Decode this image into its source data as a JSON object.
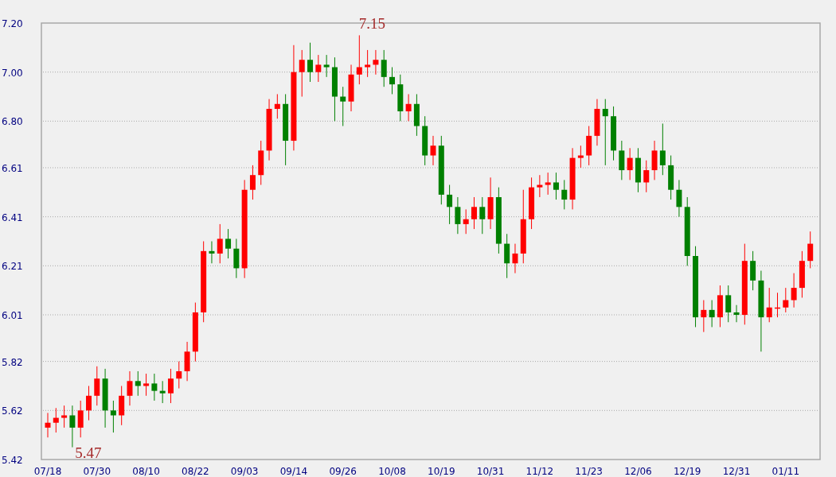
{
  "chart_data": {
    "type": "candlestick",
    "grid": true,
    "ylim": [
      5.42,
      7.2
    ],
    "yticks": [
      5.42,
      5.62,
      5.82,
      6.01,
      6.21,
      6.41,
      6.61,
      {
        "value": 6.8,
        "label": "6.80"
      },
      {
        "value": 7.0,
        "label": "7.00"
      },
      {
        "value": 7.2,
        "label": "7.20"
      }
    ],
    "categories": [
      "07/18",
      null,
      null,
      null,
      null,
      null,
      "07/30",
      null,
      null,
      null,
      null,
      null,
      "08/10",
      null,
      null,
      null,
      null,
      null,
      "08/22",
      null,
      null,
      null,
      null,
      null,
      "09/03",
      null,
      null,
      null,
      null,
      null,
      "09/14",
      null,
      null,
      null,
      null,
      null,
      "09/26",
      null,
      null,
      null,
      null,
      null,
      "10/08",
      null,
      null,
      null,
      null,
      null,
      "10/19",
      null,
      null,
      null,
      null,
      null,
      "10/31",
      null,
      null,
      null,
      null,
      null,
      "11/12",
      null,
      null,
      null,
      null,
      null,
      "11/23",
      null,
      null,
      null,
      null,
      null,
      "12/06",
      null,
      null,
      null,
      null,
      null,
      "12/19",
      null,
      null,
      null,
      null,
      null,
      "12/31",
      null,
      null,
      null,
      null,
      null,
      "01/11",
      null,
      null,
      null
    ],
    "ohlc": [
      [
        5.55,
        5.61,
        5.51,
        5.57
      ],
      [
        5.57,
        5.63,
        5.53,
        5.59
      ],
      [
        5.59,
        5.64,
        5.55,
        5.6
      ],
      [
        5.6,
        5.64,
        5.47,
        5.55
      ],
      [
        5.55,
        5.66,
        5.51,
        5.62
      ],
      [
        5.62,
        5.72,
        5.58,
        5.68
      ],
      [
        5.68,
        5.8,
        5.64,
        5.75
      ],
      [
        5.75,
        5.79,
        5.55,
        5.62
      ],
      [
        5.62,
        5.66,
        5.53,
        5.6
      ],
      [
        5.6,
        5.72,
        5.56,
        5.68
      ],
      [
        5.68,
        5.78,
        5.64,
        5.74
      ],
      [
        5.74,
        5.78,
        5.68,
        5.72
      ],
      [
        5.72,
        5.77,
        5.68,
        5.73
      ],
      [
        5.73,
        5.77,
        5.66,
        5.7
      ],
      [
        5.7,
        5.74,
        5.65,
        5.69
      ],
      [
        5.69,
        5.79,
        5.65,
        5.75
      ],
      [
        5.75,
        5.82,
        5.71,
        5.78
      ],
      [
        5.78,
        5.9,
        5.74,
        5.86
      ],
      [
        5.86,
        6.06,
        5.82,
        6.02
      ],
      [
        6.02,
        6.31,
        5.98,
        6.27
      ],
      [
        6.27,
        6.31,
        6.22,
        6.26
      ],
      [
        6.26,
        6.38,
        6.22,
        6.32
      ],
      [
        6.32,
        6.36,
        6.24,
        6.28
      ],
      [
        6.28,
        6.32,
        6.16,
        6.2
      ],
      [
        6.2,
        6.56,
        6.16,
        6.52
      ],
      [
        6.52,
        6.62,
        6.48,
        6.58
      ],
      [
        6.58,
        6.72,
        6.54,
        6.68
      ],
      [
        6.68,
        6.89,
        6.64,
        6.85
      ],
      [
        6.85,
        6.91,
        6.81,
        6.87
      ],
      [
        6.87,
        6.91,
        6.62,
        6.72
      ],
      [
        6.72,
        7.11,
        6.68,
        7.0
      ],
      [
        7.0,
        7.09,
        6.9,
        7.05
      ],
      [
        7.05,
        7.12,
        6.96,
        7.0
      ],
      [
        7.0,
        7.07,
        6.96,
        7.03
      ],
      [
        7.03,
        7.07,
        6.98,
        7.02
      ],
      [
        7.02,
        7.06,
        6.8,
        6.9
      ],
      [
        6.9,
        6.94,
        6.78,
        6.88
      ],
      [
        6.88,
        7.03,
        6.84,
        6.99
      ],
      [
        6.99,
        7.15,
        6.95,
        7.02
      ],
      [
        7.02,
        7.09,
        6.98,
        7.03
      ],
      [
        7.03,
        7.09,
        6.99,
        7.05
      ],
      [
        7.05,
        7.09,
        6.94,
        6.98
      ],
      [
        6.98,
        7.02,
        6.91,
        6.95
      ],
      [
        6.95,
        6.99,
        6.8,
        6.84
      ],
      [
        6.84,
        6.91,
        6.8,
        6.87
      ],
      [
        6.87,
        6.91,
        6.74,
        6.78
      ],
      [
        6.78,
        6.82,
        6.62,
        6.66
      ],
      [
        6.66,
        6.74,
        6.62,
        6.7
      ],
      [
        6.7,
        6.74,
        6.46,
        6.5
      ],
      [
        6.5,
        6.54,
        6.38,
        6.45
      ],
      [
        6.45,
        6.49,
        6.34,
        6.38
      ],
      [
        6.38,
        6.44,
        6.34,
        6.4
      ],
      [
        6.4,
        6.49,
        6.36,
        6.45
      ],
      [
        6.45,
        6.49,
        6.34,
        6.4
      ],
      [
        6.4,
        6.57,
        6.36,
        6.49
      ],
      [
        6.49,
        6.53,
        6.26,
        6.3
      ],
      [
        6.3,
        6.34,
        6.16,
        6.22
      ],
      [
        6.22,
        6.3,
        6.18,
        6.26
      ],
      [
        6.26,
        6.52,
        6.22,
        6.4
      ],
      [
        6.4,
        6.57,
        6.36,
        6.53
      ],
      [
        6.53,
        6.58,
        6.49,
        6.54
      ],
      [
        6.54,
        6.59,
        6.5,
        6.55
      ],
      [
        6.55,
        6.59,
        6.48,
        6.52
      ],
      [
        6.52,
        6.56,
        6.44,
        6.48
      ],
      [
        6.48,
        6.69,
        6.44,
        6.65
      ],
      [
        6.65,
        6.7,
        6.61,
        6.66
      ],
      [
        6.66,
        6.78,
        6.62,
        6.74
      ],
      [
        6.74,
        6.89,
        6.7,
        6.85
      ],
      [
        6.85,
        6.89,
        6.62,
        6.82
      ],
      [
        6.82,
        6.86,
        6.64,
        6.68
      ],
      [
        6.68,
        6.72,
        6.56,
        6.6
      ],
      [
        6.6,
        6.69,
        6.56,
        6.65
      ],
      [
        6.65,
        6.69,
        6.51,
        6.55
      ],
      [
        6.55,
        6.64,
        6.51,
        6.6
      ],
      [
        6.6,
        6.72,
        6.56,
        6.68
      ],
      [
        6.68,
        6.79,
        6.58,
        6.62
      ],
      [
        6.62,
        6.66,
        6.48,
        6.52
      ],
      [
        6.52,
        6.56,
        6.41,
        6.45
      ],
      [
        6.45,
        6.49,
        6.21,
        6.25
      ],
      [
        6.25,
        6.29,
        5.96,
        6.0
      ],
      [
        6.0,
        6.07,
        5.94,
        6.03
      ],
      [
        6.03,
        6.07,
        5.96,
        6.0
      ],
      [
        6.0,
        6.13,
        5.96,
        6.09
      ],
      [
        6.09,
        6.13,
        5.98,
        6.02
      ],
      [
        6.02,
        6.05,
        5.98,
        6.01
      ],
      [
        6.01,
        6.3,
        5.97,
        6.23
      ],
      [
        6.23,
        6.27,
        6.11,
        6.15
      ],
      [
        6.15,
        6.19,
        5.86,
        6.0
      ],
      [
        6.0,
        6.12,
        5.98,
        6.04
      ],
      [
        6.04,
        6.1,
        6.0,
        6.04
      ],
      [
        6.04,
        6.12,
        6.02,
        6.07
      ],
      [
        6.07,
        6.18,
        6.04,
        6.12
      ],
      [
        6.12,
        6.27,
        6.08,
        6.23
      ],
      [
        6.23,
        6.35,
        6.2,
        6.3
      ]
    ],
    "annotations": [
      "7.15",
      "5.47"
    ]
  }
}
